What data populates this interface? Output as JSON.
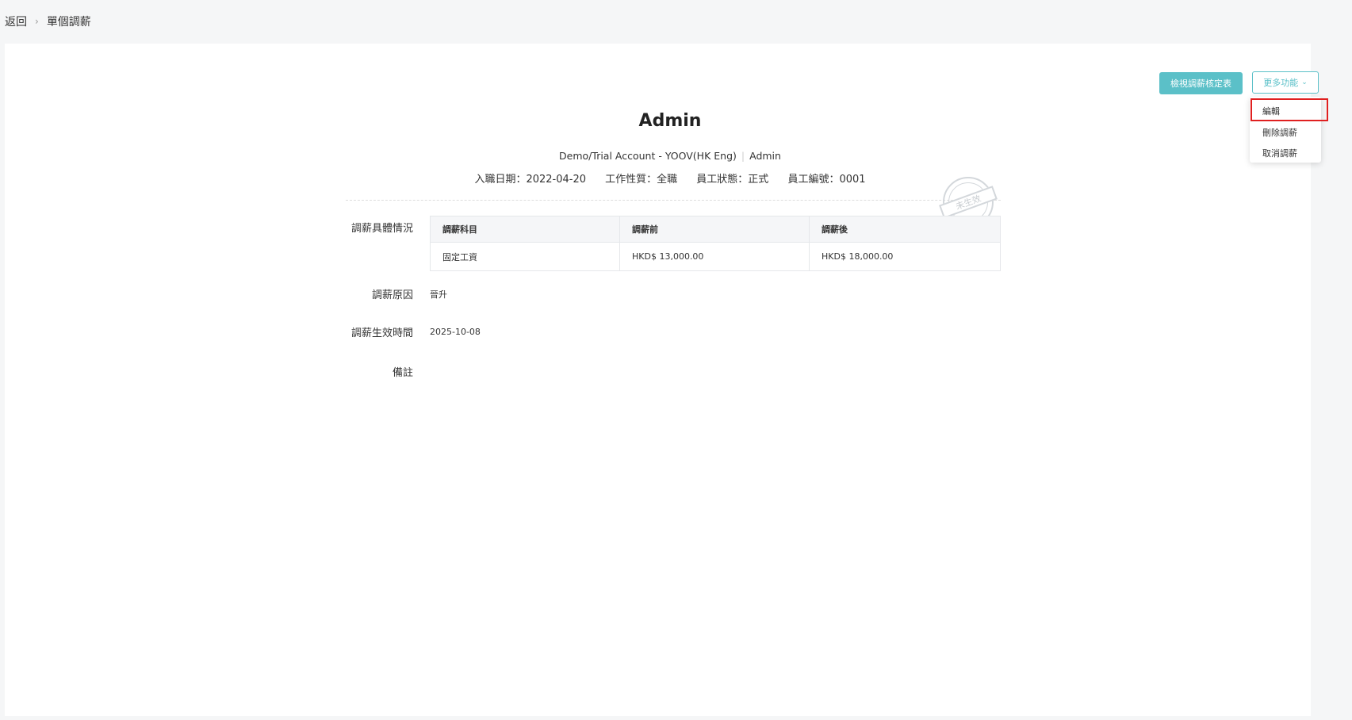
{
  "breadcrumb": {
    "back": "返回",
    "current": "單個調薪"
  },
  "toolbar": {
    "view_button": "檢視調薪核定表",
    "more_button": "更多功能"
  },
  "more_menu": {
    "items": [
      "編輯",
      "刪除調薪",
      "取消調薪"
    ]
  },
  "employee": {
    "name": "Admin",
    "company": "Demo/Trial Account - YOOV(HK Eng)",
    "role": "Admin",
    "join_date": "入職日期：2022-04-20",
    "work_type": "工作性質：全職",
    "status": "員工狀態：正式",
    "number": "員工編號：0001"
  },
  "stamp_text": "未生效",
  "details": {
    "label": "調薪具體情況",
    "headers": [
      "調薪科目",
      "調薪前",
      "調薪後"
    ],
    "rows": [
      [
        "固定工資",
        "HKD$ 13,000.00",
        "HKD$ 18,000.00"
      ]
    ]
  },
  "reason": {
    "label": "調薪原因",
    "value": "晉升"
  },
  "effective": {
    "label": "調薪生效時間",
    "value": "2025-10-08"
  },
  "remark": {
    "label": "備註",
    "value": ""
  },
  "colors": {
    "accent": "#5bc0c8",
    "highlight": "#e02020"
  }
}
